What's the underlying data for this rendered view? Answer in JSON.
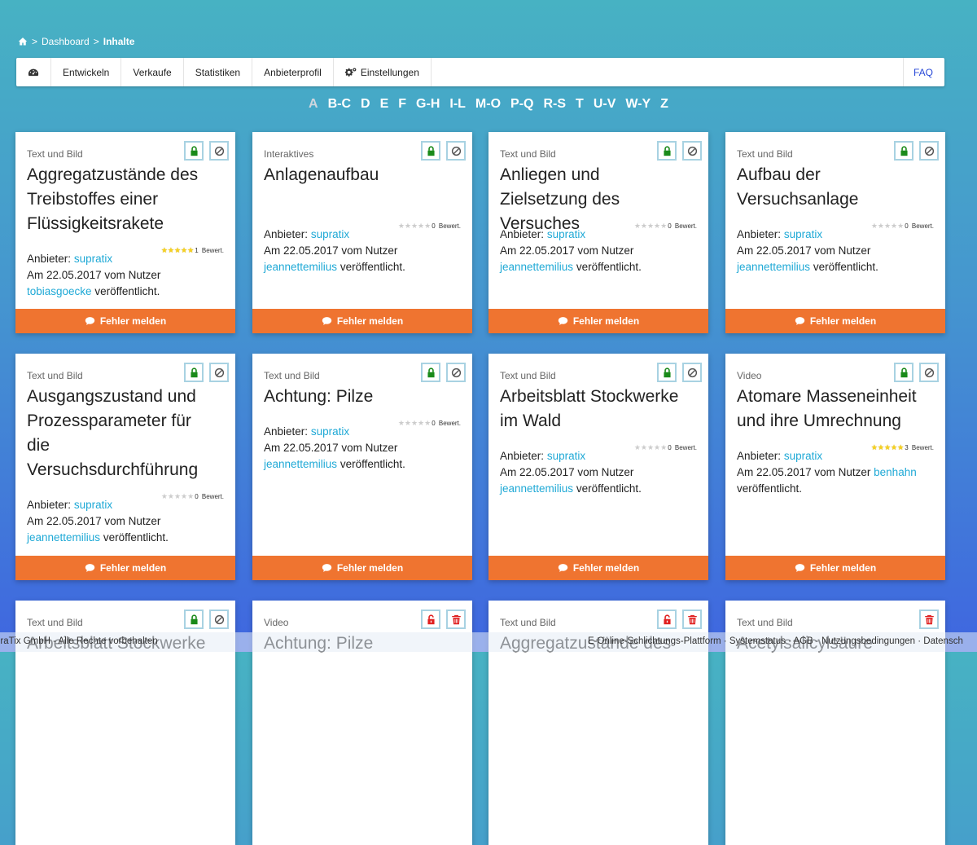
{
  "breadcrumb": {
    "sep1": ">",
    "dashboard": "Dashboard",
    "sep2": ">",
    "current": "Inhalte"
  },
  "nav": {
    "items": [
      "Entwickeln",
      "Verkaufe",
      "Statistiken",
      "Anbieterprofil",
      "Einstellungen"
    ],
    "faq": "FAQ"
  },
  "alphabet": [
    "A",
    "B-C",
    "D",
    "E",
    "F",
    "G-H",
    "I-L",
    "M-O",
    "P-Q",
    "R-S",
    "T",
    "U-V",
    "W-Y",
    "Z"
  ],
  "alphabet_active": "A",
  "labels": {
    "provider": "Anbieter:",
    "on": "Am",
    "by_user": "vom Nutzer",
    "published": "veröffentlicht.",
    "ratings_suffix": "Bewert.",
    "report": "Fehler melden",
    "stars": "★★★★★"
  },
  "colors": {
    "accent": "#ef7430",
    "link": "#1fa9d6",
    "lock_green": "#1a8a1a",
    "lock_red": "#e02020"
  },
  "cards": [
    {
      "type": "Text und Bild",
      "title": "Aggregatzustände des Treibstoffes einer Flüssigkeitsrakete",
      "provider": "supratix",
      "date": "22.05.2017",
      "user": "tobiasgoecke",
      "rating": 5,
      "ratings_count": "1",
      "lock": "locked",
      "second": "block"
    },
    {
      "type": "Interaktives",
      "title": "Anlagenaufbau",
      "provider": "supratix",
      "date": "22.05.2017",
      "user": "jeannettemilius",
      "rating": 0,
      "ratings_count": "0",
      "lock": "locked",
      "second": "block"
    },
    {
      "type": "Text und Bild",
      "title": "Anliegen und Zielsetzung des Versuches",
      "provider": "supratix",
      "date": "22.05.2017",
      "user": "jeannettemilius",
      "rating": 0,
      "ratings_count": "0",
      "lock": "locked",
      "second": "block"
    },
    {
      "type": "Text und Bild",
      "title": "Aufbau der Versuchsanlage",
      "provider": "supratix",
      "date": "22.05.2017",
      "user": "jeannettemilius",
      "rating": 0,
      "ratings_count": "0",
      "lock": "locked",
      "second": "block"
    },
    {
      "type": "Text und Bild",
      "title": "Ausgangszustand und Prozessparameter für die Versuchsdurchführung",
      "provider": "supratix",
      "date": "22.05.2017",
      "user": "jeannettemilius",
      "rating": 0,
      "ratings_count": "0",
      "lock": "locked",
      "second": "block"
    },
    {
      "type": "Text und Bild",
      "title": "Achtung: Pilze",
      "provider": "supratix",
      "date": "22.05.2017",
      "user": "jeannettemilius",
      "rating": 0,
      "ratings_count": "0",
      "lock": "locked",
      "second": "block"
    },
    {
      "type": "Text und Bild",
      "title": "Arbeitsblatt Stockwerke im Wald",
      "provider": "supratix",
      "date": "22.05.2017",
      "user": "jeannettemilius",
      "rating": 0,
      "ratings_count": "0",
      "lock": "locked",
      "second": "block"
    },
    {
      "type": "Video",
      "title": "Atomare Masseneinheit und ihre Umrechnung",
      "provider": "supratix",
      "date": "22.05.2017",
      "user": "benhahn",
      "rating": 5,
      "ratings_count": "3",
      "lock": "locked",
      "second": "block"
    },
    {
      "type": "Text und Bild",
      "title": "Arbeitsblatt Stockwerke",
      "lock": "locked",
      "second": "block"
    },
    {
      "type": "Video",
      "title": "Achtung: Pilze",
      "lock": "unlocked",
      "second": "trash"
    },
    {
      "type": "Text und Bild",
      "title": "Aggregatzustände des",
      "lock": "unlocked",
      "second": "trash"
    },
    {
      "type": "Text und Bild",
      "title": "Acetylsalicylsäure",
      "lock": "none",
      "second": "trash"
    }
  ],
  "footer": {
    "left": "praTix GmbH - Alle Rechte vorbehalten",
    "right": "E-Online-Schlichtungs-Plattform · Systemstatus · AGB · Nutzungsbedingungen · Datensch"
  }
}
